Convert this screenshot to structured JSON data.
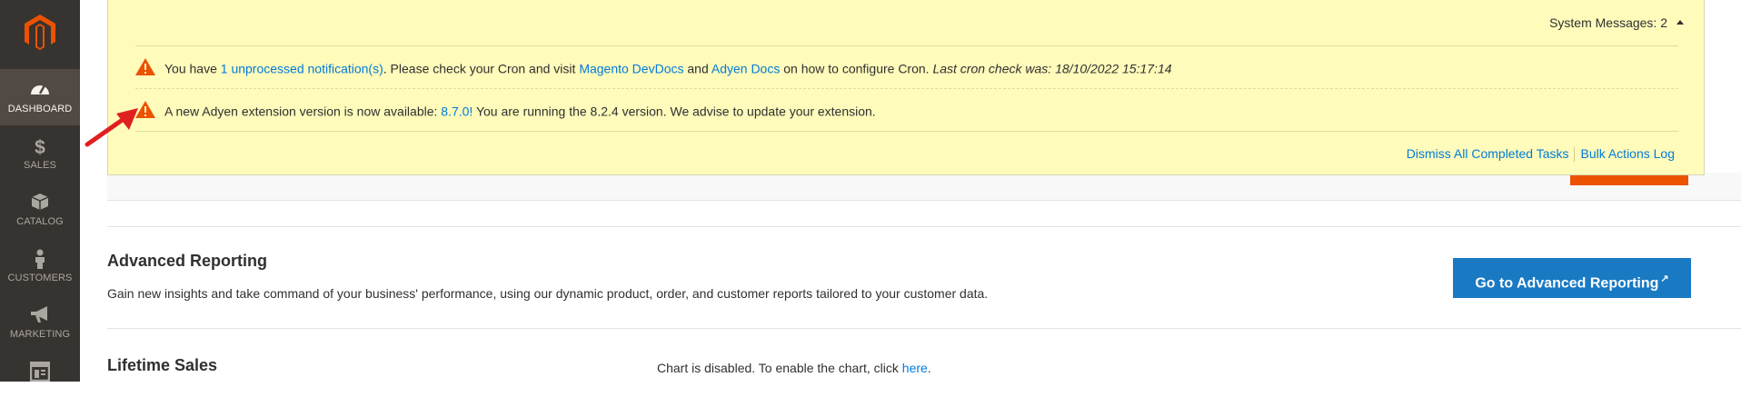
{
  "sidebar": {
    "logo_icon": "magento-logo-icon",
    "items": [
      {
        "label": "DASHBOARD",
        "icon": "dashboard-icon",
        "active": true
      },
      {
        "label": "SALES",
        "icon": "dollar-icon"
      },
      {
        "label": "CATALOG",
        "icon": "box-icon"
      },
      {
        "label": "CUSTOMERS",
        "icon": "person-icon"
      },
      {
        "label": "MARKETING",
        "icon": "megaphone-icon"
      },
      {
        "label": "",
        "icon": "content-icon"
      }
    ]
  },
  "system_messages": {
    "header": "System Messages: 2",
    "messages": [
      {
        "icon": "warning-icon",
        "text_1": "You have ",
        "link_1": "1 unprocessed notification(s)",
        "text_2": ". Please check your Cron and visit ",
        "link_2": "Magento DevDocs",
        "text_3": " and ",
        "link_3": "Adyen Docs",
        "text_4": " on how to configure Cron. ",
        "italic": "Last cron check was: 18/10/2022 15:17:14"
      },
      {
        "icon": "warning-icon",
        "text_1": "A new Adyen extension version is now available: ",
        "link_1": "8.7.0!",
        "text_2": " You are running the 8.2.4 version. We advise to update your extension."
      }
    ],
    "actions": {
      "dismiss": "Dismiss All Completed Tasks",
      "bulk_log": "Bulk Actions Log"
    }
  },
  "advanced_reporting": {
    "title": "Advanced Reporting",
    "description": "Gain new insights and take command of your business' performance, using our dynamic product, order, and customer reports tailored to your customer data.",
    "button_label": "Go to Advanced Reporting",
    "button_icon": "external-link-icon"
  },
  "lifetime_sales": {
    "title": "Lifetime Sales"
  },
  "chart": {
    "text": "Chart is disabled. To enable the chart, click ",
    "link": "here",
    "tail": "."
  },
  "colors": {
    "sidebar_bg": "#373330",
    "sidebar_active": "#514943",
    "message_bg": "#fffbbb",
    "link": "#007bdb",
    "primary_button": "#1979c3",
    "accent_orange": "#eb5202",
    "warning": "#eb5202",
    "annotation_arrow": "#e02020"
  }
}
